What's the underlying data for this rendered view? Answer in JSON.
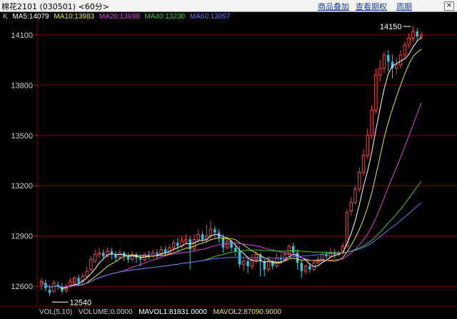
{
  "window": {
    "title": "棉花2101 (030501) <60分>",
    "buttons": [
      "商品叠加",
      "查看期权",
      "周期"
    ]
  },
  "indicators": {
    "k_label": "K",
    "ma5": "MA5:14079",
    "ma10": "MA10:13983",
    "ma20": "MA20:13698",
    "ma40": "MA40:13230",
    "ma60": "MA60:13097"
  },
  "colors": {
    "ma5": "#ffffff",
    "ma10": "#e8e81a",
    "ma20": "#e040e0",
    "ma40": "#30d030",
    "ma60": "#7070ff",
    "up": "#ff4040",
    "down": "#20c8e0",
    "grid": "#800000"
  },
  "volume_bar": {
    "vol": "VOL(5,10)",
    "volume": "VOLUME:0.0000",
    "mavol1": "MAVOL1:81831.0000",
    "mavol2": "MAVOL2:87090.9000"
  },
  "chart_data": {
    "type": "candlestick",
    "y_ticks": [
      "14100",
      "13800",
      "13500",
      "13200",
      "12900",
      "12600"
    ],
    "ylim": [
      12520,
      14180
    ],
    "annotations": {
      "high": "14150",
      "low": "12540"
    },
    "candles": [
      [
        12610,
        12630,
        12580,
        12650
      ],
      [
        12620,
        12590,
        12570,
        12640
      ],
      [
        12580,
        12560,
        12540,
        12610
      ],
      [
        12570,
        12620,
        12560,
        12640
      ],
      [
        12610,
        12600,
        12580,
        12630
      ],
      [
        12600,
        12570,
        12555,
        12620
      ],
      [
        12575,
        12600,
        12560,
        12615
      ],
      [
        12600,
        12630,
        12590,
        12650
      ],
      [
        12620,
        12650,
        12600,
        12660
      ],
      [
        12650,
        12620,
        12600,
        12670
      ],
      [
        12630,
        12660,
        12610,
        12680
      ],
      [
        12660,
        12690,
        12650,
        12720
      ],
      [
        12700,
        12760,
        12690,
        12780
      ],
      [
        12750,
        12790,
        12740,
        12820
      ],
      [
        12790,
        12800,
        12770,
        12830
      ],
      [
        12800,
        12780,
        12760,
        12820
      ],
      [
        12780,
        12810,
        12770,
        12830
      ],
      [
        12810,
        12790,
        12760,
        12830
      ],
      [
        12790,
        12770,
        12750,
        12810
      ],
      [
        12770,
        12800,
        12760,
        12820
      ],
      [
        12800,
        12780,
        12750,
        12810
      ],
      [
        12780,
        12760,
        12740,
        12800
      ],
      [
        12760,
        12790,
        12750,
        12810
      ],
      [
        12790,
        12770,
        12740,
        12800
      ],
      [
        12770,
        12760,
        12720,
        12790
      ],
      [
        12760,
        12790,
        12750,
        12800
      ],
      [
        12790,
        12780,
        12760,
        12810
      ],
      [
        12780,
        12800,
        12770,
        12820
      ],
      [
        12800,
        12790,
        12760,
        12820
      ],
      [
        12790,
        12820,
        12780,
        12840
      ],
      [
        12820,
        12800,
        12780,
        12840
      ],
      [
        12800,
        12830,
        12790,
        12850
      ],
      [
        12830,
        12860,
        12810,
        12880
      ],
      [
        12860,
        12840,
        12810,
        12890
      ],
      [
        12840,
        12870,
        12830,
        12900
      ],
      [
        12870,
        12880,
        12850,
        12910
      ],
      [
        12880,
        12820,
        12700,
        12900
      ],
      [
        12820,
        12880,
        12810,
        12910
      ],
      [
        12880,
        12910,
        12860,
        12940
      ],
      [
        12910,
        12880,
        12860,
        12930
      ],
      [
        12880,
        12900,
        12860,
        12970
      ],
      [
        12900,
        12940,
        12880,
        12990
      ],
      [
        12940,
        12920,
        12890,
        12960
      ],
      [
        12920,
        12890,
        12860,
        12940
      ],
      [
        12890,
        12830,
        12800,
        12910
      ],
      [
        12830,
        12870,
        12820,
        12880
      ],
      [
        12870,
        12830,
        12810,
        12880
      ],
      [
        12830,
        12810,
        12780,
        12850
      ],
      [
        12810,
        12730,
        12710,
        12840
      ],
      [
        12730,
        12750,
        12690,
        12770
      ],
      [
        12750,
        12720,
        12680,
        12780
      ],
      [
        12720,
        12760,
        12700,
        12790
      ],
      [
        12760,
        12790,
        12740,
        12810
      ],
      [
        12790,
        12750,
        12660,
        12800
      ],
      [
        12750,
        12700,
        12660,
        12770
      ],
      [
        12700,
        12750,
        12690,
        12780
      ],
      [
        12750,
        12720,
        12700,
        12760
      ],
      [
        12720,
        12770,
        12710,
        12800
      ],
      [
        12770,
        12760,
        12740,
        12790
      ],
      [
        12760,
        12790,
        12750,
        12810
      ],
      [
        12790,
        12840,
        12770,
        12850
      ],
      [
        12840,
        12800,
        12780,
        12860
      ],
      [
        12800,
        12740,
        12700,
        12820
      ],
      [
        12740,
        12690,
        12650,
        12760
      ],
      [
        12690,
        12720,
        12670,
        12730
      ],
      [
        12720,
        12700,
        12680,
        12740
      ],
      [
        12700,
        12740,
        12690,
        12750
      ],
      [
        12740,
        12760,
        12730,
        12780
      ],
      [
        12760,
        12790,
        12750,
        12800
      ],
      [
        12790,
        12780,
        12760,
        12810
      ],
      [
        12780,
        12800,
        12770,
        12830
      ],
      [
        12800,
        12790,
        12770,
        12820
      ],
      [
        12790,
        12800,
        12780,
        12810
      ],
      [
        12800,
        12840,
        12790,
        12860
      ],
      [
        12840,
        13040,
        12830,
        13060
      ],
      [
        13050,
        13100,
        13020,
        13130
      ],
      [
        13100,
        13180,
        13090,
        13200
      ],
      [
        13180,
        13280,
        13160,
        13310
      ],
      [
        13280,
        13380,
        13260,
        13420
      ],
      [
        13380,
        13500,
        13360,
        13540
      ],
      [
        13500,
        13650,
        13480,
        13680
      ],
      [
        13650,
        13860,
        13630,
        13900
      ],
      [
        13860,
        13900,
        13820,
        13950
      ],
      [
        13900,
        13980,
        13870,
        14000
      ],
      [
        13980,
        13940,
        13880,
        14010
      ],
      [
        13940,
        13900,
        13840,
        13980
      ],
      [
        13900,
        13920,
        13860,
        13960
      ],
      [
        13920,
        13980,
        13900,
        14010
      ],
      [
        13980,
        14040,
        13960,
        14060
      ],
      [
        14040,
        14080,
        14020,
        14110
      ],
      [
        14080,
        14120,
        14060,
        14150
      ],
      [
        14120,
        14090,
        14060,
        14140
      ],
      [
        14090,
        14100,
        14070,
        14120
      ]
    ]
  }
}
